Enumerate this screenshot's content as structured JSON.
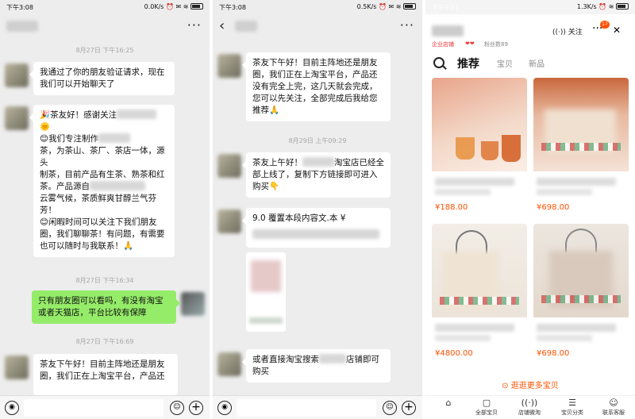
{
  "panel1": {
    "status": {
      "time": "下午3:08",
      "speed": "0.0K/s"
    },
    "messages": {
      "ts1": "8月27日 下午16:25",
      "m1": [
        "我通过了你的朋友验证请求，现在",
        "我们可以开始聊天了"
      ],
      "m2": [
        "🎉茶友好！感谢关注",
        "🌞",
        "😊我们专注制作",
        "茶，为茶山、茶厂、茶店一体，源头",
        "制茶，目前产品有生茶、熟茶和红",
        "茶。产品源自",
        "云雾气候，茶质鲜爽甘醇兰气芬",
        "芳！",
        "😊闲暇时间可以关注下我们朋友",
        "圈，我们聊聊茶！有问题，有需要",
        "也可以随时与我联系！🙏"
      ],
      "ts2": "8月27日 下午16:34",
      "m3": [
        "只有朋友圈可以看吗，有没有淘宝",
        "或者天猫店，平台比较有保障"
      ],
      "ts3": "8月27日 下午16:69",
      "m4": [
        "茶友下午好！目前主阵地还是朋友",
        "圈，我们正在上淘宝平台，产品还"
      ]
    }
  },
  "panel2": {
    "status": {
      "time": "下午3:08",
      "speed": "0.5K/s"
    },
    "messages": {
      "m1": [
        "茶友下午好！目前主阵地还是朋友",
        "圈，我们正在上淘宝平台，产品还",
        "没有完全上完，这几天就会完成，",
        "您可以先关注，全部完成后我给您",
        "推荐🙏"
      ],
      "ts1": "8月29日 上午09:29",
      "m2": [
        "茶友上午好！",
        "淘宝店已经全",
        "部上线了，复制下方链接即可进入",
        "购买👇"
      ],
      "m3": "9.0 覆置本段内容文.本 ¥",
      "m4": [
        "或者直接淘宝搜索",
        "店铺即可",
        "购买"
      ]
    }
  },
  "panel3": {
    "status": {
      "time": "下午3:13",
      "speed": "1.3K/s"
    },
    "follow": "关注",
    "badge": "17",
    "tag_red": "企业店铺",
    "tag_fans": "粉丝数89",
    "tabs": {
      "active": "推荐",
      "t2": "宝贝",
      "t3": "新品"
    },
    "prices": [
      "¥188.00",
      "¥698.00",
      "¥4800.00",
      "¥698.00"
    ],
    "more_goods": "逛逛更多宝贝",
    "nav": [
      "全部宝贝",
      "店铺微淘",
      "宝贝分类",
      "联系客服"
    ]
  },
  "colors": {
    "accent": "#ff5000",
    "wechat_green": "#95ec69",
    "chat_bg": "#ededed"
  }
}
